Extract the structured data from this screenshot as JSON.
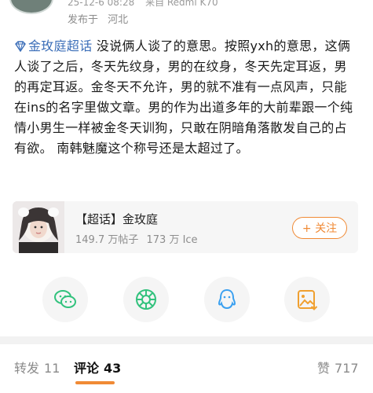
{
  "header": {
    "timestamp": "25-12-6 08:28",
    "device": "来自 Redmi K70",
    "location_prefix": "发布于",
    "location": "河北"
  },
  "post": {
    "topic": "金玫庭超话",
    "text": " 没说俩人谈了的意思。按照yxh的意思，这俩人谈了之后，冬天先纹身，男的在纹身，冬天先定耳返，男的再定耳返。金冬天不允许，男的就不准有一点风声，只能在ins的名字里做文章。男的作为出道多年的大前辈跟一个纯情小男生一样被金冬天训狗，只敢在阴暗角落散发自己的占有欲。 南韩魅魔这个称号还是太超过了。"
  },
  "topic_card": {
    "title": "【超话】金玫庭",
    "posts": "149.7 万帖子",
    "fans": "173 万 Ice",
    "follow_label": "+ 关注"
  },
  "share": {
    "items": [
      "wechat-icon",
      "moments-icon",
      "qq-icon",
      "save-image-icon"
    ],
    "colors": {
      "wechat": "#32c27d",
      "moments": "#32c27d",
      "qq": "#3aa0f0",
      "save": "#f0a030"
    }
  },
  "tabs": {
    "repost_label": "转发",
    "repost_count": "11",
    "comment_label": "评论",
    "comment_count": "43",
    "like_label": "赞",
    "like_count": "717"
  },
  "colors": {
    "accent": "#f08a35",
    "link": "#3b6eb8"
  }
}
